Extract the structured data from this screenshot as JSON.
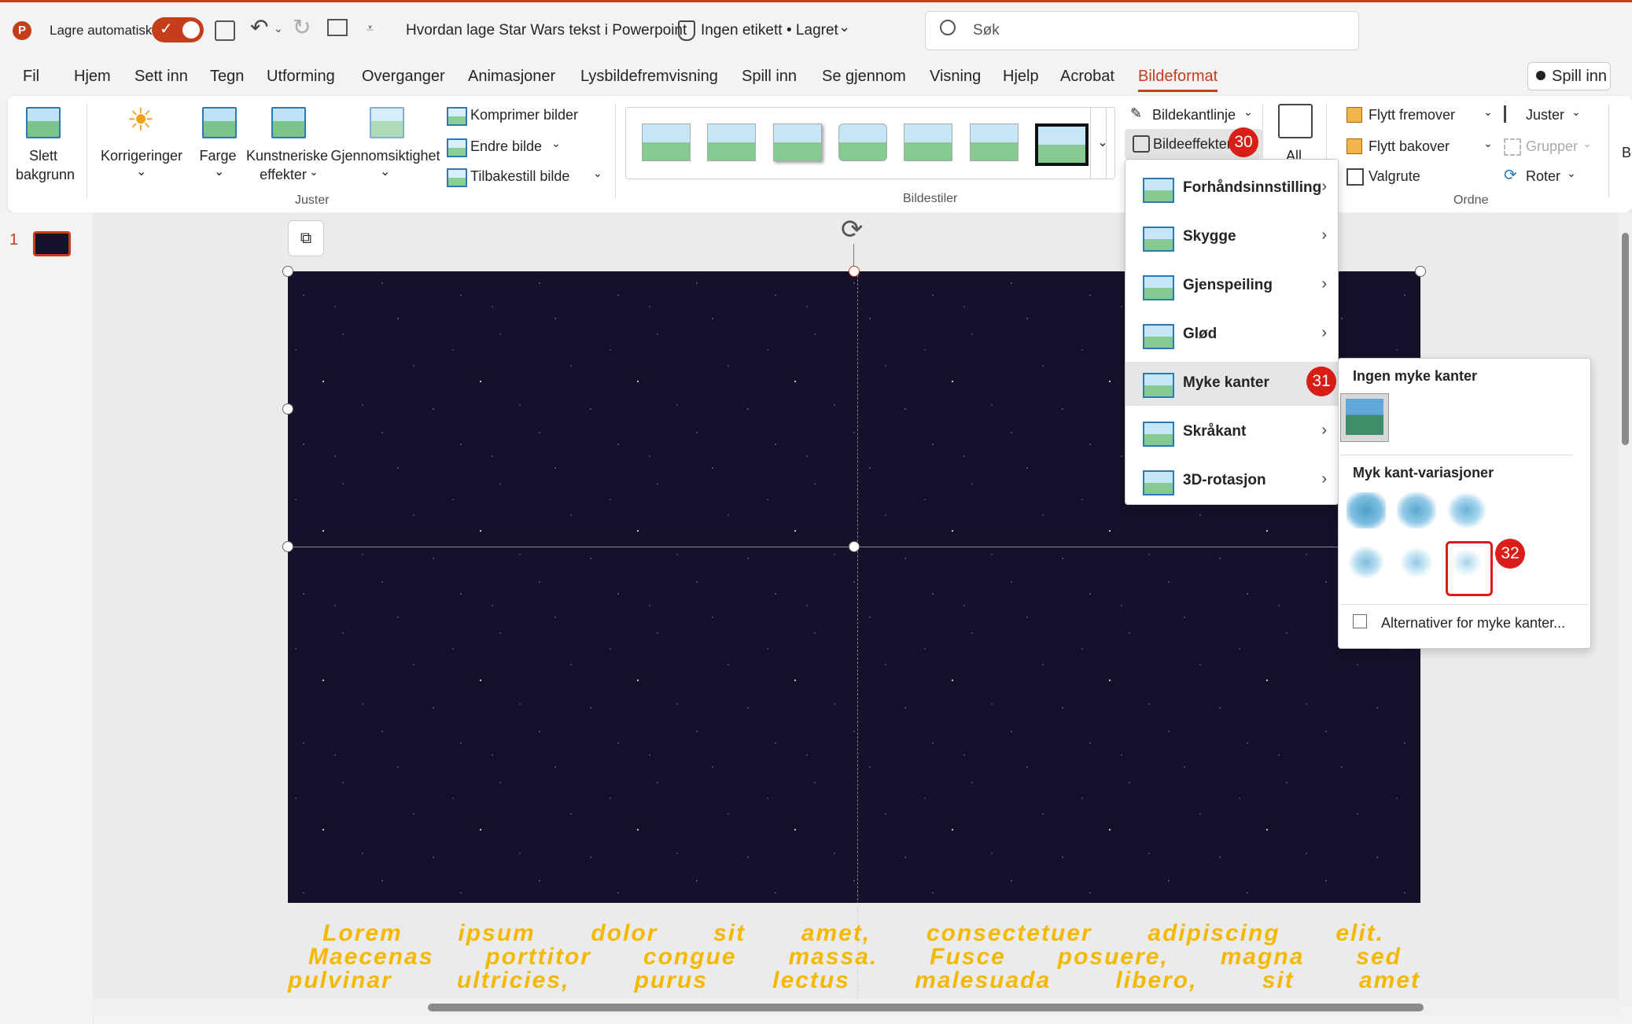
{
  "titlebar": {
    "autosave_label": "Lagre automatisk",
    "doc_title": "Hvordan lage Star Wars tekst i Powerpoint",
    "label": "Ingen etikett",
    "saved": "• Lagret",
    "search_placeholder": "Søk"
  },
  "tabs": [
    "Fil",
    "Hjem",
    "Sett inn",
    "Tegn",
    "Utforming",
    "Overganger",
    "Animasjoner",
    "Lysbildefremvisning",
    "Spill inn",
    "Se gjennom",
    "Visning",
    "Hjelp",
    "Acrobat",
    "Bildeformat"
  ],
  "record_button": "Spill inn",
  "ribbon": {
    "remove_bg": [
      "Slett",
      "bakgrunn"
    ],
    "corrections": "Korrigeringer",
    "color": "Farge",
    "artistic": [
      "Kunstneriske",
      "effekter"
    ],
    "transparency": "Gjennomsiktighet",
    "compress": "Komprimer bilder",
    "change": "Endre bilde",
    "reset": "Tilbakestill bilde",
    "group_adjust": "Juster",
    "group_styles": "Bildestiler",
    "border": "Bildekantlinje",
    "effects": "Bildeeffekter",
    "alt": "All",
    "forward": "Flytt fremover",
    "backward": "Flytt bakover",
    "selection": "Valgrute",
    "align": "Juster",
    "group": "Grupper",
    "rotate": "Roter",
    "group_arrange": "Ordne",
    "cut_b": "Be"
  },
  "slide_number": "1",
  "lorem": [
    "Lorem ipsum dolor sit amet, consectetuer adipiscing elit.",
    "Maecenas porttitor congue massa. Fusce posuere, magna sed",
    "pulvinar ultricies, purus lectus malesuada libero, sit amet"
  ],
  "effects_menu": [
    "Forhåndsinnstilling",
    "Skygge",
    "Gjenspeiling",
    "Glød",
    "Myke kanter",
    "Skråkant",
    "3D-rotasjon"
  ],
  "soft_menu": {
    "none_title": "Ingen myke kanter",
    "variations_title": "Myk kant-variasjoner",
    "options_link": "Alternativer for myke kanter..."
  },
  "badges": [
    "30",
    "31",
    "32"
  ],
  "colors": {
    "accent": "#c43e1c",
    "badge": "#d91e18",
    "lorem": "#f5b800"
  }
}
